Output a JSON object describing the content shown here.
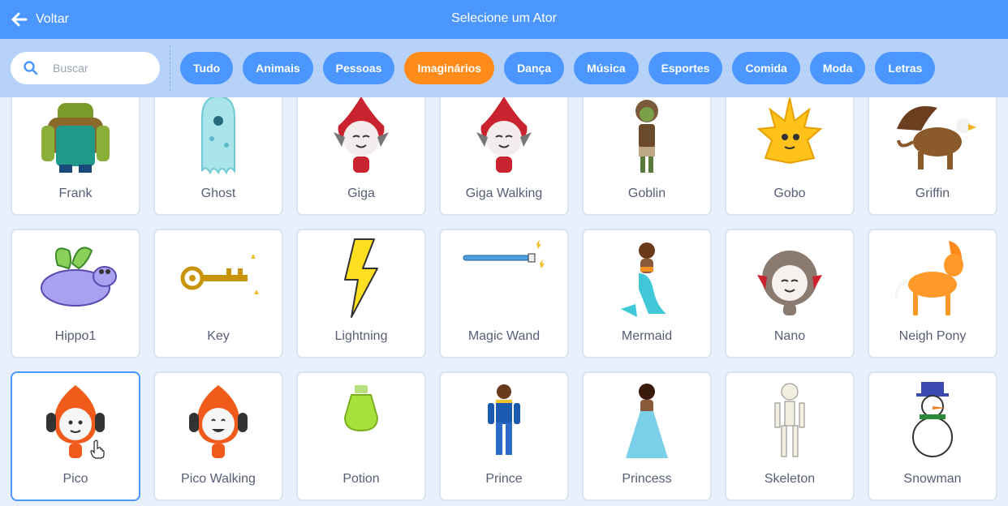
{
  "header": {
    "back_label": "Voltar",
    "title": "Selecione um Ator"
  },
  "search": {
    "placeholder": "Buscar",
    "value": ""
  },
  "tags": [
    {
      "label": "Tudo",
      "active": false
    },
    {
      "label": "Animais",
      "active": false
    },
    {
      "label": "Pessoas",
      "active": false
    },
    {
      "label": "Imaginários",
      "active": true
    },
    {
      "label": "Dança",
      "active": false
    },
    {
      "label": "Música",
      "active": false
    },
    {
      "label": "Esportes",
      "active": false
    },
    {
      "label": "Comida",
      "active": false
    },
    {
      "label": "Moda",
      "active": false
    },
    {
      "label": "Letras",
      "active": false
    }
  ],
  "sprites": [
    {
      "name": "Frank"
    },
    {
      "name": "Ghost"
    },
    {
      "name": "Giga"
    },
    {
      "name": "Giga Walking"
    },
    {
      "name": "Goblin"
    },
    {
      "name": "Gobo"
    },
    {
      "name": "Griffin"
    },
    {
      "name": "Hippo1"
    },
    {
      "name": "Key"
    },
    {
      "name": "Lightning"
    },
    {
      "name": "Magic Wand"
    },
    {
      "name": "Mermaid"
    },
    {
      "name": "Nano"
    },
    {
      "name": "Neigh Pony"
    },
    {
      "name": "Pico",
      "selected": true
    },
    {
      "name": "Pico Walking"
    },
    {
      "name": "Potion"
    },
    {
      "name": "Prince"
    },
    {
      "name": "Princess"
    },
    {
      "name": "Skeleton"
    },
    {
      "name": "Snowman"
    }
  ],
  "colors": {
    "header": "#4c97ff",
    "filter_bar": "#b7d2f8",
    "active_tag": "#ff8c1a",
    "tag": "#4c97ff"
  }
}
